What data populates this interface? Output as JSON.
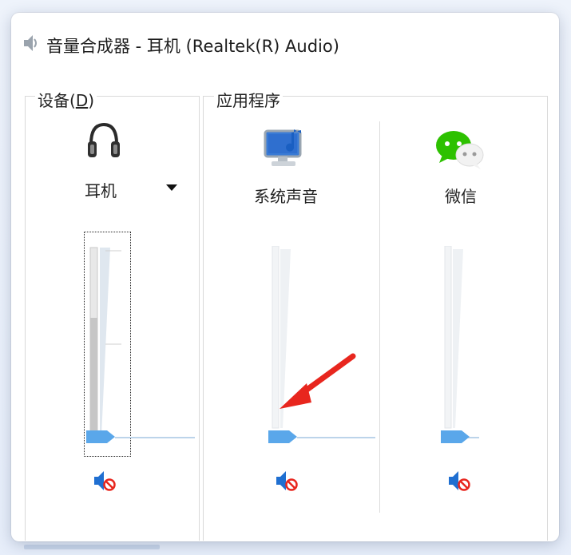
{
  "window": {
    "title": "音量合成器 - 耳机 (Realtek(R) Audio)"
  },
  "device_group": {
    "label_prefix": "设备(",
    "label_hotkey": "D",
    "label_suffix": ")",
    "device_name": "耳机",
    "icon": "headphones-icon",
    "level_fraction": 0.6,
    "volume_fraction": 0.0,
    "muted": true
  },
  "apps_group": {
    "label": "应用程序",
    "apps": [
      {
        "name": "系统声音",
        "icon": "system-sounds-icon",
        "volume_fraction": 0.0,
        "muted": true
      },
      {
        "name": "微信",
        "icon": "wechat-icon",
        "volume_fraction": 0.0,
        "muted": true
      }
    ]
  },
  "annotation": {
    "arrow_color": "#e8261e"
  },
  "colors": {
    "thumb": "#5aa7ea",
    "mute_speaker": "#1f6fd1",
    "mute_badge": "#e8261e",
    "wechat": "#2dc100"
  }
}
